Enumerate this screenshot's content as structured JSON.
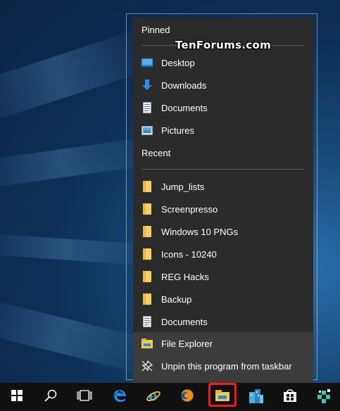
{
  "watermark": "TenForums.com",
  "jumplist": {
    "pinned_title": "Pinned",
    "pinned": [
      {
        "label": "Desktop",
        "icon": "desktop-folder-icon"
      },
      {
        "label": "Downloads",
        "icon": "downloads-arrow-icon"
      },
      {
        "label": "Documents",
        "icon": "documents-icon"
      },
      {
        "label": "Pictures",
        "icon": "pictures-icon"
      }
    ],
    "recent_title": "Recent",
    "recent": [
      {
        "label": "Jump_lists",
        "icon": "folder-icon"
      },
      {
        "label": "Screenpresso",
        "icon": "folder-icon"
      },
      {
        "label": "Windows 10 PNGs",
        "icon": "folder-icon"
      },
      {
        "label": "Icons - 10240",
        "icon": "folder-icon"
      },
      {
        "label": "REG Hacks",
        "icon": "folder-icon"
      },
      {
        "label": "Backup",
        "icon": "folder-icon"
      },
      {
        "label": "Documents",
        "icon": "documents-icon"
      }
    ],
    "actions": [
      {
        "label": "File Explorer",
        "icon": "file-explorer-icon"
      },
      {
        "label": "Unpin this program from taskbar",
        "icon": "unpin-icon"
      }
    ]
  },
  "taskbar": {
    "items": [
      {
        "name": "start-button",
        "icon": "windows-logo-icon"
      },
      {
        "name": "search-button",
        "icon": "search-icon"
      },
      {
        "name": "task-view-button",
        "icon": "task-view-icon"
      },
      {
        "name": "edge-button",
        "icon": "edge-icon"
      },
      {
        "name": "internet-explorer-button",
        "icon": "internet-explorer-icon"
      },
      {
        "name": "firefox-button",
        "icon": "firefox-icon"
      },
      {
        "name": "file-explorer-button",
        "icon": "file-explorer-icon"
      },
      {
        "name": "app-button",
        "icon": "buildings-icon"
      },
      {
        "name": "store-button",
        "icon": "store-icon"
      },
      {
        "name": "app-button-2",
        "icon": "puzzle-icon"
      }
    ],
    "highlight_color": "#ff1a1a"
  }
}
